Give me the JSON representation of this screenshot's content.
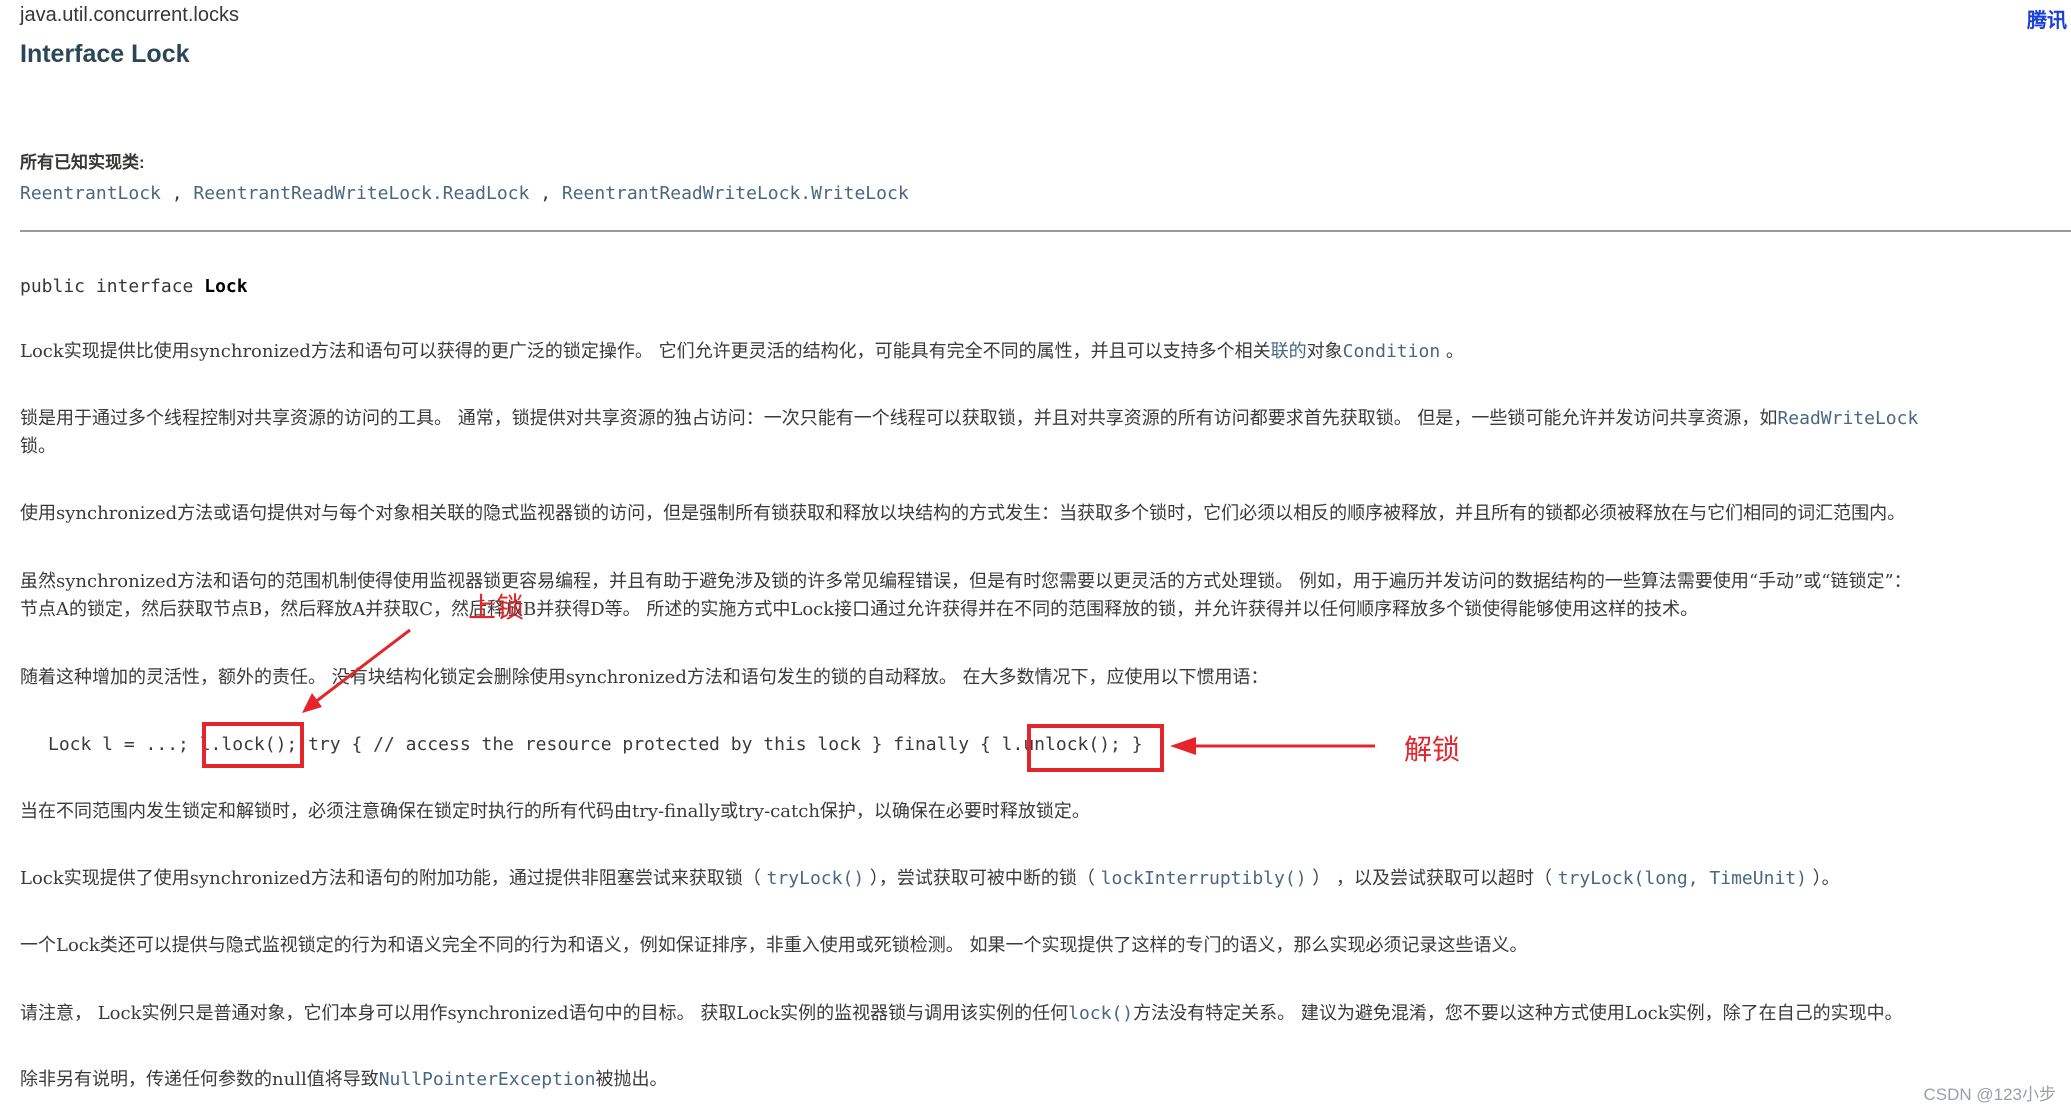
{
  "header": {
    "package": "java.util.concurrent.locks",
    "title": "Interface Lock",
    "corner_text": "腾讯"
  },
  "implementing": {
    "label": "所有已知实现类:",
    "classes": [
      "ReentrantLock",
      "ReentrantReadWriteLock.ReadLock",
      "ReentrantReadWriteLock.WriteLock"
    ],
    "sep1": " , ",
    "sep2": " , "
  },
  "declaration": {
    "prefix": "public interface ",
    "name": "Lock"
  },
  "p1": {
    "a": "Lock实现提供比使用synchronized方法和语句可以获得的更广泛的锁定操作。 它们允许更灵活的结构化，可能具有完全不同的属性，并且可以支持多个相关",
    "link": "联的",
    "b": "对象",
    "cond": "Condition",
    "c": " 。"
  },
  "p2": {
    "line1": "锁是用于通过多个线程控制对共享资源的访问的工具。 通常，锁提供对共享资源的独占访问：一次只能有一个线程可以获取锁，并且对共享资源的所有访问都要求首先获取锁。 但是，一些锁可能允许并发访问共享资源，如",
    "link": "ReadWriteLock",
    "line2": "锁。"
  },
  "p3": "使用synchronized方法或语句提供对与每个对象相关联的隐式监视器锁的访问，但是强制所有锁获取和释放以块结构的方式发生：当获取多个锁时，它们必须以相反的顺序被释放，并且所有的锁都必须被释放在与它们相同的词汇范围内。",
  "p4": {
    "line1": "虽然synchronized方法和语句的范围机制使得使用监视器锁更容易编程，并且有助于避免涉及锁的许多常见编程错误，但是有时您需要以更灵活的方式处理锁。 例如，用于遍历并发访问的数据结构的一些算法需要使用“手动”或“链锁定”：",
    "line2": "节点A的锁定，然后获取节点B，然后释放A并获取C，然后释放B并获得D等。 所述的实施方式中Lock接口通过允许获得并在不同的范围释放的锁，并允许获得并以任何顺序释放多个锁使得能够使用这样的技术。"
  },
  "p5": "随着这种增加的灵活性，额外的责任。 没有块结构化锁定会删除使用synchronized方法和语句发生的锁的自动释放。 在大多数情况下，应使用以下惯用语：",
  "code": {
    "a": "Lock l = ...; ",
    "lock_call": "l.lock()",
    "b": "; try { // access the resource protected by this lock } finally { ",
    "unlock_call": "l.unlock()",
    "c": "; }"
  },
  "p6": "当在不同范围内发生锁定和解锁时，必须注意确保在锁定时执行的所有代码由try-finally或try-catch保护，以确保在必要时释放锁定。",
  "p7": {
    "a": "Lock实现提供了使用synchronized方法和语句的附加功能，通过提供非阻塞尝试来获取锁（ ",
    "m1": "tryLock()",
    "b": " ），尝试获取可被中断的锁（ ",
    "m2": "lockInterruptibly()",
    "c": " ） ，以及尝试获取可以超时（ ",
    "m3": "tryLock(long, TimeUnit)",
    "d": " ）。"
  },
  "p8": "一个Lock类还可以提供与隐式监视锁定的行为和语义完全不同的行为和语义，例如保证排序，非重入使用或死锁检测。 如果一个实现提供了这样的专门的语义，那么实现必须记录这些语义。",
  "p9": {
    "a": "请注意， Lock实例只是普通对象，它们本身可以用作synchronized语句中的目标。 获取Lock实例的监视器锁与调用该实例的任何",
    "m": "lock()",
    "b": "方法没有特定关系。 建议为避免混淆，您不要以这种方式使用Lock实例，除了在自己的实现中。"
  },
  "p10": {
    "a": "除非另有说明，传递任何参数的null值将导致",
    "link": "NullPointerException",
    "b": "被抛出。"
  },
  "annotations": {
    "lock_label": "上锁",
    "unlock_label": "解锁",
    "color": "#e4252c"
  },
  "watermark": "CSDN @123小步"
}
